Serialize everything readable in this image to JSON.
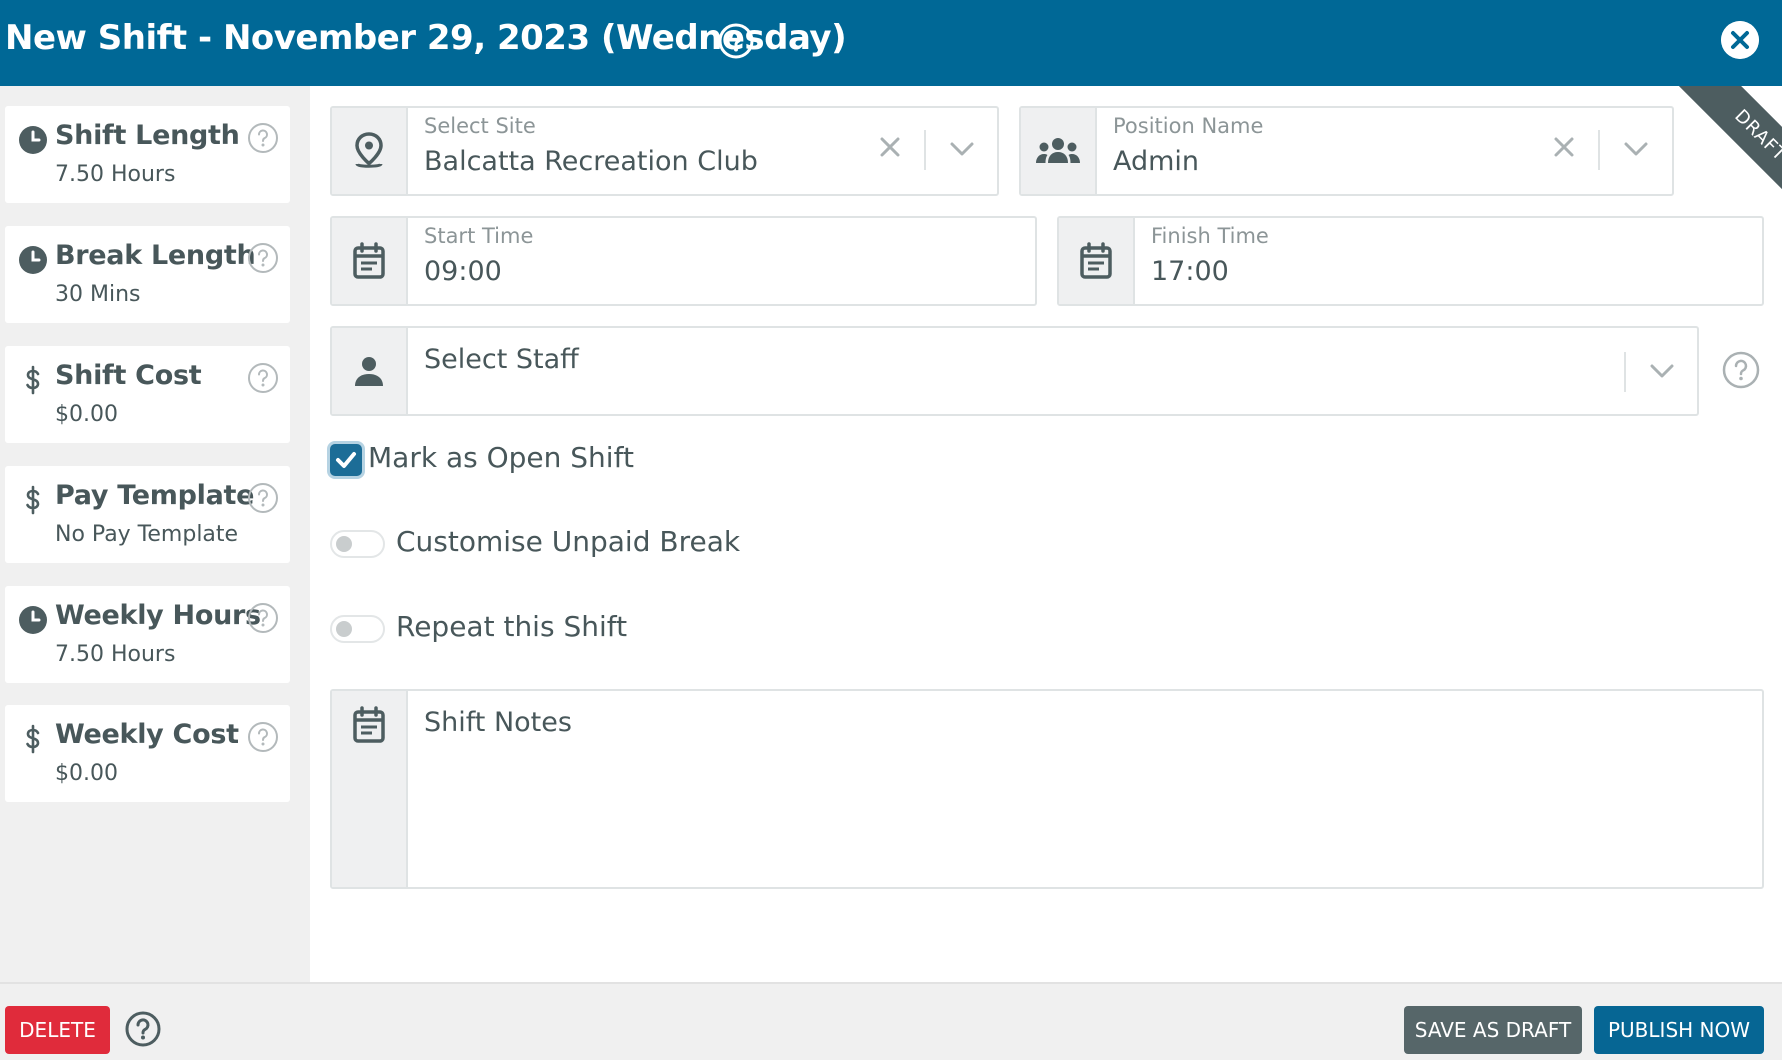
{
  "header": {
    "title": "New Shift - November 29, 2023 (Wednesday)",
    "help_icon": "question-circle-icon",
    "close_icon": "close-icon",
    "background_color": "#006896"
  },
  "sidebar": {
    "cards": [
      {
        "icon": "clock-icon",
        "title": "Shift Length",
        "value": "7.50 Hours"
      },
      {
        "icon": "clock-icon",
        "title": "Break Length",
        "value": "30 Mins"
      },
      {
        "icon": "dollar-icon",
        "title": "Shift Cost",
        "value": "$0.00"
      },
      {
        "icon": "dollar-icon",
        "title": "Pay Template",
        "value": "No Pay Template"
      },
      {
        "icon": "clock-icon",
        "title": "Weekly Hours",
        "value": "7.50 Hours"
      },
      {
        "icon": "dollar-icon",
        "title": "Weekly Cost",
        "value": "$0.00"
      }
    ]
  },
  "form": {
    "site": {
      "label": "Select Site",
      "value": "Balcatta Recreation Club",
      "icon": "map-pin-icon"
    },
    "position": {
      "label": "Position Name",
      "value": "Admin",
      "icon": "users-icon"
    },
    "start_time": {
      "label": "Start Time",
      "value": "09:00",
      "icon": "calendar-icon"
    },
    "finish_time": {
      "label": "Finish Time",
      "value": "17:00",
      "icon": "calendar-icon"
    },
    "staff": {
      "placeholder": "Select Staff",
      "icon": "person-icon"
    },
    "open_shift": {
      "label": "Mark as Open Shift",
      "checked": true
    },
    "unpaid_break": {
      "label": "Customise Unpaid Break",
      "enabled": false
    },
    "repeat": {
      "label": "Repeat this Shift",
      "enabled": false
    },
    "notes": {
      "placeholder": "Shift Notes",
      "value": "",
      "icon": "calendar-icon"
    }
  },
  "ribbon": {
    "label": "DRAFT"
  },
  "footer": {
    "delete_label": "DELETE",
    "save_draft_label": "SAVE AS DRAFT",
    "publish_label": "PUBLISH NOW"
  },
  "colors": {
    "primary": "#006896",
    "danger": "#e02b3b",
    "draft_button": "#566669",
    "publish_button": "#066694",
    "text": "#48575a"
  }
}
